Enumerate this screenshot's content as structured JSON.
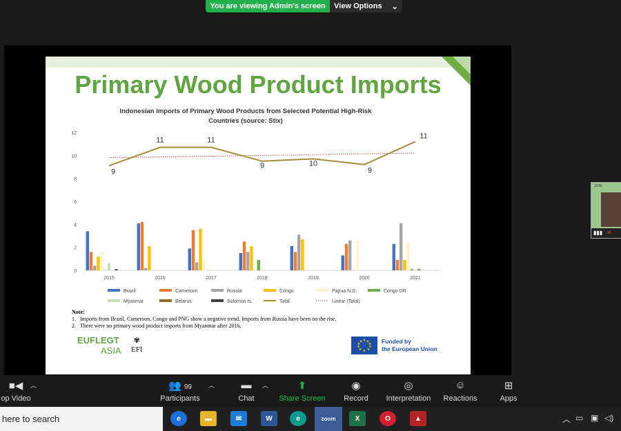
{
  "share_banner": {
    "viewing_text": "You are viewing Admin's screen",
    "view_options": "View Options"
  },
  "slide": {
    "title": "Primary Wood Product Imports",
    "chart_title_line1": "Indonesian Imports of Primary Wood Products from Selected Potential High-Risk",
    "chart_title_line2": "Countries (source: Stix)",
    "note_heading": "Note:",
    "notes": [
      {
        "num": "1.",
        "text": "Imports from Brazil, Cameroon, Congo and PNG show a negative trend. Imports from Russia have been on the rise."
      },
      {
        "num": "2.",
        "text": "There were no primary wood product imports from Myanmar after 2016."
      }
    ],
    "logo_eu_line1": "EUFLEGT",
    "logo_eu_line2": "ASIA",
    "logo_efi": "EFI",
    "funded_line1": "Funded by",
    "funded_line2": "the European Union"
  },
  "chart_data": {
    "type": "bar",
    "title": "Indonesian Imports of Primary Wood Products from Selected Potential High-Risk Countries (source: Stix)",
    "categories": [
      "2015",
      "2016",
      "2017",
      "2018",
      "2019",
      "2020",
      "2021"
    ],
    "ylim": [
      0,
      12
    ],
    "yticks": [
      "0",
      "2",
      "4",
      "6",
      "8",
      "10",
      "12"
    ],
    "series": [
      {
        "name": "Brazil",
        "color": "#4472c4",
        "values": [
          3.4,
          4.1,
          1.9,
          1.5,
          2.1,
          1.3,
          2.3
        ]
      },
      {
        "name": "Cameroon",
        "color": "#ed7d31",
        "values": [
          1.6,
          4.2,
          3.5,
          2.5,
          1.6,
          2.3,
          0.9
        ]
      },
      {
        "name": "Russia",
        "color": "#a5a5a5",
        "values": [
          0.4,
          0.2,
          0.7,
          1.6,
          3.1,
          2.6,
          4.1
        ]
      },
      {
        "name": "Congo",
        "color": "#ffc000",
        "values": [
          1.2,
          2.1,
          3.6,
          2.1,
          2.7,
          0.0,
          0.9
        ]
      },
      {
        "name": "Papua N.G.",
        "color": "#fff2cc",
        "values": [
          1.6,
          0.0,
          0.9,
          0.0,
          0.0,
          2.6,
          2.4
        ]
      },
      {
        "name": "Congo DR",
        "color": "#70ad47",
        "values": [
          0.0,
          0.0,
          0.0,
          0.9,
          0.0,
          0.0,
          0.1
        ]
      },
      {
        "name": "Myanmar",
        "color": "#c5e0b4",
        "values": [
          0.6,
          0.0,
          0.0,
          0.0,
          0.0,
          0.0,
          0.0
        ]
      },
      {
        "name": "Belarus",
        "color": "#9c6b1f",
        "values": [
          0.0,
          0.0,
          0.0,
          0.0,
          0.0,
          0.0,
          0.1
        ]
      },
      {
        "name": "Solomon Is.",
        "color": "#404040",
        "values": [
          0.1,
          0.0,
          0.0,
          0.0,
          0.0,
          0.0,
          0.0
        ]
      }
    ],
    "total": {
      "name": "Total",
      "color": "#a68b3a",
      "values": [
        9,
        11,
        11,
        9,
        10,
        9,
        11
      ],
      "plotted": [
        9.1,
        10.7,
        10.7,
        9.5,
        9.7,
        9.2,
        11.2
      ]
    },
    "linear_total": {
      "name": "Linear (Total)",
      "color": "#c0504d",
      "start": 9.8,
      "end": 10.2
    },
    "legend": [
      "Brazil",
      "Cameroon",
      "Russia",
      "Congo",
      "Papua N.G.",
      "Congo DR",
      "Myanmar",
      "Belarus",
      "Solomon Is.",
      "Total",
      "Linear (Total)"
    ],
    "legend_position": "bottom",
    "grid": false
  },
  "thumbnail": {
    "label": "JOIN"
  },
  "controls": [
    {
      "id": "video",
      "label": "op Video"
    },
    {
      "id": "participants",
      "label": "Participants",
      "count": "99"
    },
    {
      "id": "chat",
      "label": "Chat"
    },
    {
      "id": "share",
      "label": "Share Screen"
    },
    {
      "id": "record",
      "label": "Record"
    },
    {
      "id": "interpretation",
      "label": "Interpretation"
    },
    {
      "id": "reactions",
      "label": "Reactions"
    },
    {
      "id": "apps",
      "label": "Apps"
    }
  ],
  "taskbar": {
    "search_placeholder": "here to search",
    "apps": [
      "edge-browser",
      "file-explorer",
      "mail",
      "word",
      "edge",
      "zoom",
      "excel",
      "opera",
      "game"
    ],
    "zoom_label": "zoom",
    "word_label": "W",
    "excel_label": "X"
  }
}
